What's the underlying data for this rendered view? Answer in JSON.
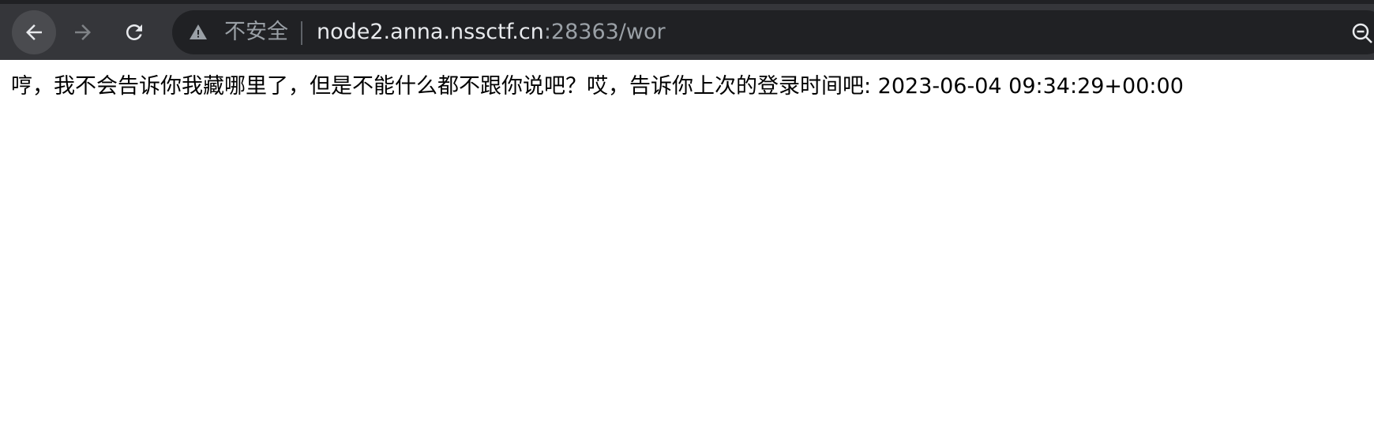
{
  "toolbar": {
    "back_icon": "arrow-left-icon",
    "forward_icon": "arrow-right-icon",
    "reload_icon": "reload-icon"
  },
  "omnibox": {
    "security_icon": "warning-triangle-icon",
    "security_label": "不安全",
    "url_host": "node2.anna.nssctf.cn",
    "url_rest": ":28363/wor",
    "zoom_icon": "zoom-out-icon"
  },
  "page": {
    "message": "哼，我不会告诉你我藏哪里了，但是不能什么都不跟你说吧？哎，告诉你上次的登录时间吧: 2023-06-04 09:34:29+00:00"
  },
  "colors": {
    "toolbar_bg": "#35363a",
    "omnibox_bg": "#202124",
    "url_host": "#e8eaed",
    "url_dim": "#9aa0a6",
    "page_bg": "#ffffff",
    "page_text": "#000000"
  }
}
